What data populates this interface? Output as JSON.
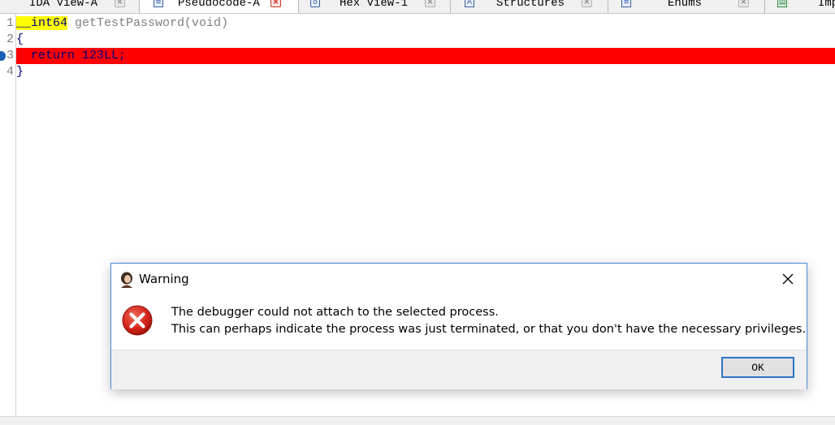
{
  "tabs": [
    {
      "label": "IDA View-A",
      "icon": "ida-view-icon",
      "active": false
    },
    {
      "label": "Pseudocode-A",
      "icon": "pseudocode-icon",
      "active": true
    },
    {
      "label": "Hex View-1",
      "icon": "hex-view-icon",
      "active": false
    },
    {
      "label": "Structures",
      "icon": "structures-icon",
      "active": false
    },
    {
      "label": "Enums",
      "icon": "enums-icon",
      "active": false
    },
    {
      "label": "Imp",
      "icon": "imports-icon",
      "active": false
    }
  ],
  "code": {
    "lines": [
      {
        "num": "1",
        "type_kw": "__int64",
        "rest": " getTestPassword(void)"
      },
      {
        "num": "2",
        "text": "{"
      },
      {
        "num": "3",
        "text": "  return 123LL;"
      },
      {
        "num": "4",
        "text": "}"
      }
    ],
    "highlight_color": "#ff0000",
    "keyword_highlight_color": "#ffff00"
  },
  "dialog": {
    "title": "Warning",
    "message_line1": "The debugger could not attach to the selected process.",
    "message_line2": "This can perhaps indicate the process was just terminated, or that you don't have the necessary privileges.",
    "ok_label": "OK"
  }
}
